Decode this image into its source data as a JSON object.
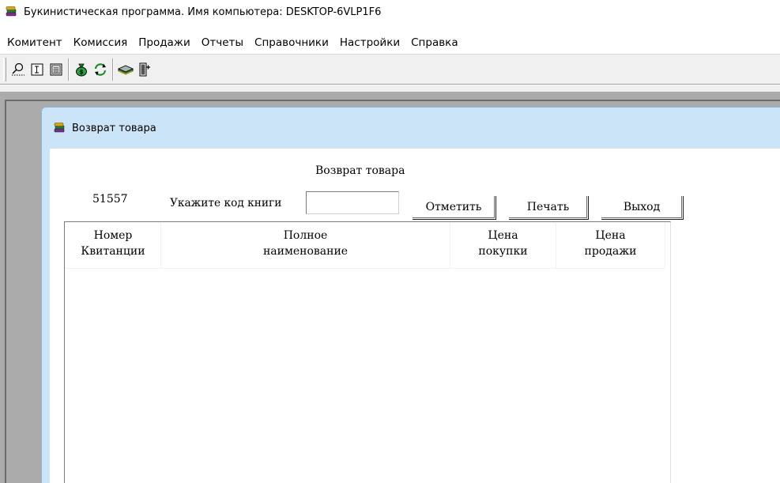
{
  "window": {
    "title": "Букинистическая программа. Имя компьютера: DESKTOP-6VLP1F6"
  },
  "menu": [
    "Комитент",
    "Комиссия",
    "Продажи",
    "Отчеты",
    "Справочники",
    "Настройки",
    "Справка"
  ],
  "toolbar": {
    "buttons": [
      {
        "icon": "search-icon"
      },
      {
        "icon": "form-icon"
      },
      {
        "icon": "list-icon"
      },
      {
        "icon": "money-bag-icon"
      },
      {
        "icon": "refresh-icon"
      },
      {
        "icon": "book-icon"
      },
      {
        "icon": "exit-icon"
      }
    ]
  },
  "child": {
    "title": "Возврат товара",
    "heading": "Возврат товара",
    "counter": "51557",
    "code_label": "Укажите код книги",
    "code_value": "",
    "buttons": {
      "mark": "Отметить",
      "print": "Печать",
      "exit": "Выход"
    },
    "grid": {
      "columns": [
        {
          "line1": "Номер",
          "line2": "Квитанции"
        },
        {
          "line1": "Полное",
          "line2": "наименование"
        },
        {
          "line1": "Цена",
          "line2": "покупки"
        },
        {
          "line1": "Цена",
          "line2": "продажи"
        }
      ],
      "rows": []
    }
  }
}
